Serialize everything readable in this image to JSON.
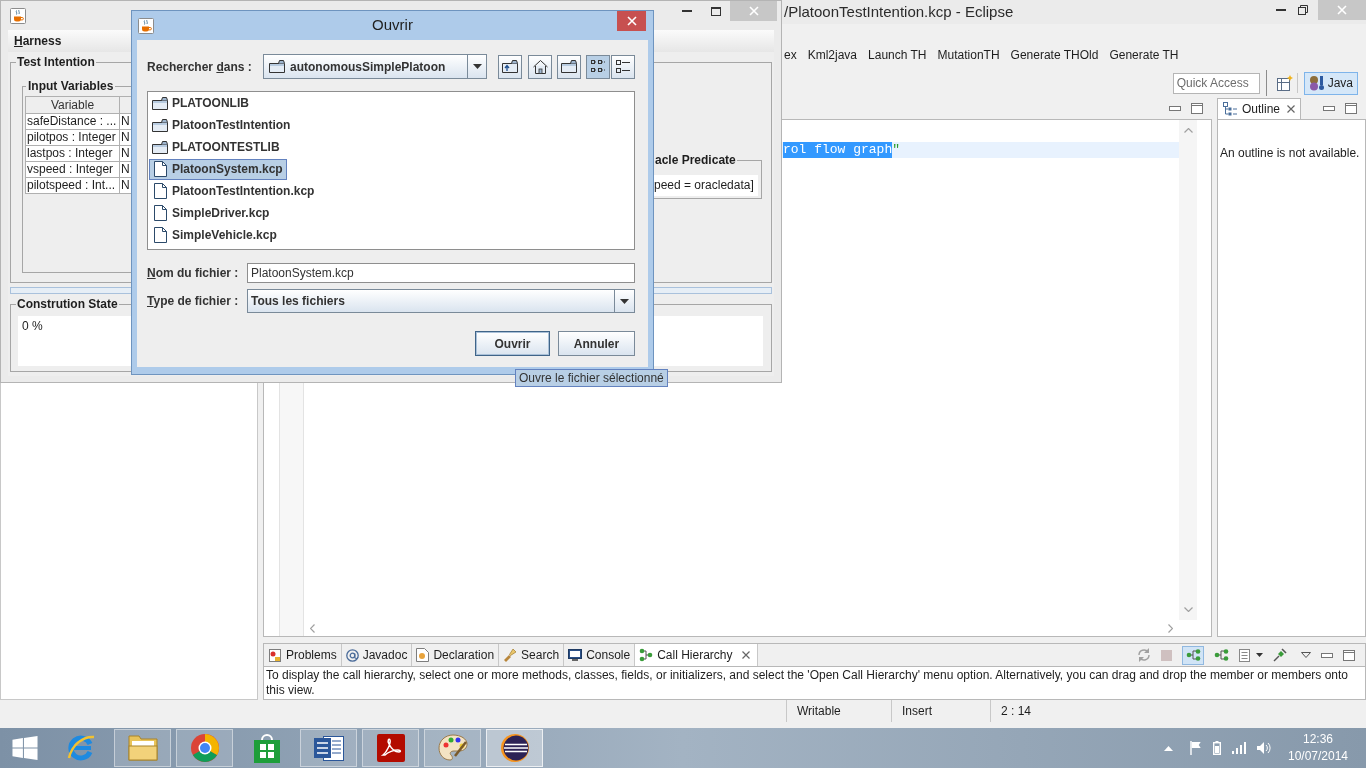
{
  "eclipse_window": {
    "title": "/PlatoonTestIntention.kcp - Eclipse",
    "toolbar": [
      "ex",
      "Kml2java",
      "Launch TH",
      "MutationTH",
      "Generate THOld",
      "Generate TH"
    ],
    "quick_access": {
      "placeholder": "Quick Access"
    },
    "perspectives": [
      {
        "label": "Java",
        "selected": true
      }
    ],
    "editor": {
      "current_line": [
        {
          "kind": "selection",
          "text": "rol flow graph"
        },
        {
          "kind": "string",
          "text": "\""
        }
      ]
    },
    "outline": {
      "tab": "Outline",
      "message": "An outline is not available."
    },
    "bottom_panel": {
      "tabs": [
        {
          "kind": "problems",
          "label": "Problems",
          "selected": false
        },
        {
          "kind": "javadoc",
          "label": "Javadoc",
          "selected": false
        },
        {
          "kind": "declaration",
          "label": "Declaration",
          "selected": false
        },
        {
          "kind": "search",
          "label": "Search",
          "selected": false
        },
        {
          "kind": "console",
          "label": "Console",
          "selected": false
        },
        {
          "kind": "call-hierarchy",
          "label": "Call Hierarchy",
          "selected": true
        }
      ],
      "message": "To display the call hierarchy, select one or more methods, classes, fields, or initializers, and select the 'Open Call Hierarchy' menu option. Alternatively, you can drag and drop the member or members onto this view."
    },
    "status_bar": [
      "Writable",
      "Insert",
      "2 : 14"
    ]
  },
  "harness_window": {
    "menu": [
      {
        "mnemonic": "H",
        "after": "arness"
      }
    ],
    "test_intention": {
      "title": "Test Intention",
      "input_variables": {
        "title": "Input Variables",
        "columns": [
          "Variable"
        ],
        "rows": [
          [
            "safeDistance : ...",
            "N"
          ],
          [
            "pilotpos : Integer",
            "N"
          ],
          [
            "lastpos : Integer",
            "N"
          ],
          [
            "vspeed : Integer",
            "N"
          ],
          [
            "pilotspeed : Int...",
            "N"
          ]
        ]
      },
      "oracle_predicate": {
        "title": "acle Predicate",
        "value": "peed = oracledata]"
      }
    },
    "construction_state": {
      "title": "Constrution State",
      "value": "0 %"
    }
  },
  "open_dialog": {
    "title": "Ouvrir",
    "look_in": {
      "label": {
        "before": "Rechercher ",
        "mnemonic": "d",
        "after": "ans :"
      },
      "value": "autonomousSimplePlatoon"
    },
    "view_modes": [
      {
        "kind": "list",
        "selected": true
      },
      {
        "kind": "details",
        "selected": false
      }
    ],
    "files": [
      {
        "kind": "folder",
        "name": "PLATOONLIB",
        "selected": false
      },
      {
        "kind": "folder",
        "name": "PlatoonTestIntention",
        "selected": false
      },
      {
        "kind": "folder",
        "name": "PLATOONTESTLIB",
        "selected": false
      },
      {
        "kind": "file",
        "name": "PlatoonSystem.kcp",
        "selected": true
      },
      {
        "kind": "file",
        "name": "PlatoonTestIntention.kcp",
        "selected": false
      },
      {
        "kind": "file",
        "name": "SimpleDriver.kcp",
        "selected": false
      },
      {
        "kind": "file",
        "name": "SimpleVehicle.kcp",
        "selected": false
      }
    ],
    "file_name": {
      "label": {
        "mnemonic": "N",
        "after": "om du fichier :"
      },
      "value": "PlatoonSystem.kcp"
    },
    "file_type": {
      "label": {
        "mnemonic": "T",
        "after": "ype de fichier :"
      },
      "value": "Tous les fichiers"
    },
    "buttons": [
      {
        "label": "Ouvrir",
        "default": true
      },
      {
        "label": "Annuler",
        "default": false
      }
    ]
  },
  "tooltip": {
    "text": "Ouvre le fichier sélectionné"
  },
  "taskbar": {
    "apps": [
      {
        "kind": "internet-explorer",
        "running": false,
        "selected": false
      },
      {
        "kind": "file-explorer",
        "running": true,
        "selected": false
      },
      {
        "kind": "chrome",
        "running": true,
        "selected": false
      },
      {
        "kind": "store",
        "running": false,
        "selected": false
      },
      {
        "kind": "word",
        "running": true,
        "selected": false
      },
      {
        "kind": "acrobat",
        "running": true,
        "selected": false
      },
      {
        "kind": "paint",
        "running": true,
        "selected": false
      },
      {
        "kind": "eclipse",
        "running": true,
        "selected": true
      }
    ],
    "time": "12:36",
    "date": "10/07/2014"
  }
}
